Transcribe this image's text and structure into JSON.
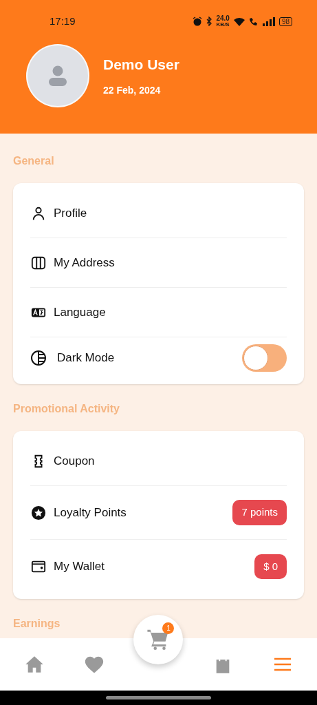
{
  "status_bar": {
    "time": "17:19",
    "speed": "24.0",
    "speed_unit": "KB/S",
    "battery": "98"
  },
  "profile": {
    "name": "Demo User",
    "date": "22 Feb, 2024"
  },
  "sections": [
    {
      "title": "General",
      "items": [
        {
          "kind": "link",
          "label": "Profile"
        },
        {
          "kind": "link",
          "label": "My Address"
        },
        {
          "kind": "link",
          "label": "Language"
        },
        {
          "kind": "toggle",
          "label": "Dark Mode",
          "on": false
        }
      ]
    },
    {
      "title": "Promotional Activity",
      "items": [
        {
          "kind": "link",
          "label": "Coupon"
        },
        {
          "kind": "badge",
          "label": "Loyalty Points",
          "badge": "7 points"
        },
        {
          "kind": "badge",
          "label": "My Wallet",
          "badge": "$ 0"
        }
      ]
    },
    {
      "title": "Earnings"
    }
  ],
  "bottom_nav": [
    {
      "selected": false
    },
    {
      "selected": false
    },
    {
      "selected": false,
      "badge": "1"
    },
    {
      "selected": false
    },
    {
      "selected": true
    }
  ]
}
